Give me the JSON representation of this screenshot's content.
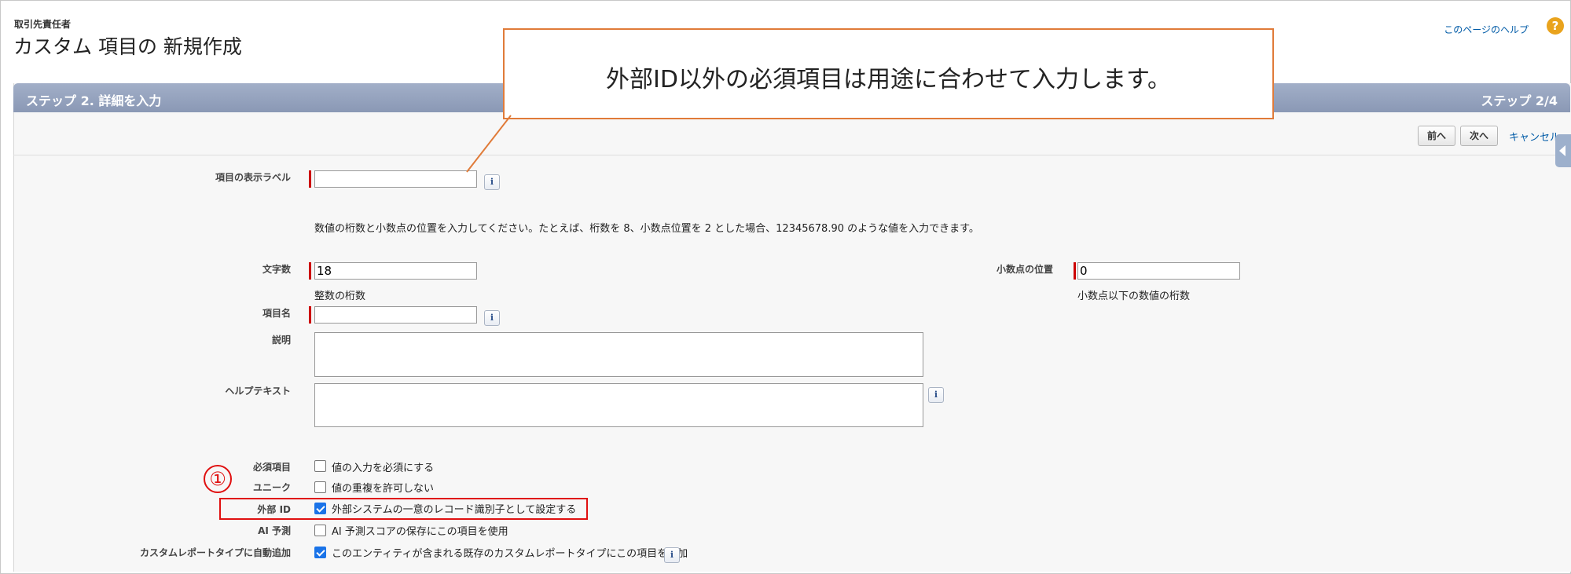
{
  "header": {
    "object_label": "取引先責任者",
    "page_title": "カスタム 項目の 新規作成",
    "help_link": "このページのヘルプ",
    "help_icon": "?"
  },
  "step": {
    "title": "ステップ 2. 詳細を入力",
    "count": "ステップ 2/4"
  },
  "buttons": {
    "prev": "前へ",
    "next": "次へ",
    "cancel": "キャンセル"
  },
  "form": {
    "field_label": {
      "label": "項目の表示ラベル",
      "value": ""
    },
    "instruction": "数値の桁数と小数点の位置を入力してください。たとえば、桁数を 8、小数点位置を 2 とした場合、12345678.90 のような値を入力できます。",
    "length": {
      "label": "文字数",
      "value": "18",
      "hint": "整数の桁数"
    },
    "decimal": {
      "label": "小数点の位置",
      "value": "0",
      "hint": "小数点以下の数値の桁数"
    },
    "field_name": {
      "label": "項目名",
      "value": ""
    },
    "description": {
      "label": "説明"
    },
    "help_text": {
      "label": "ヘルプテキスト"
    },
    "required": {
      "label": "必須項目",
      "text": "値の入力を必須にする",
      "checked": false
    },
    "unique": {
      "label": "ユニーク",
      "text": "値の重複を許可しない",
      "checked": false
    },
    "external_id": {
      "label": "外部 ID",
      "text": "外部システムの一意のレコード識別子として設定する",
      "checked": true
    },
    "ai_prediction": {
      "label": "AI 予測",
      "text": "AI 予測スコアの保存にこの項目を使用",
      "checked": false
    },
    "report_type": {
      "label": "カスタムレポートタイプに自動追加",
      "text": "このエンティティが含まれる既存のカスタムレポートタイプにこの項目を追加",
      "checked": true
    },
    "info_glyph": "i"
  },
  "annotation": {
    "callout": "外部ID以外の必須項目は用途に合わせて入力します。",
    "marker": "①"
  },
  "colors": {
    "step_bar": "#8a98b5",
    "callout_border": "#e07b39",
    "highlight": "#e01010",
    "link": "#015ba7"
  }
}
